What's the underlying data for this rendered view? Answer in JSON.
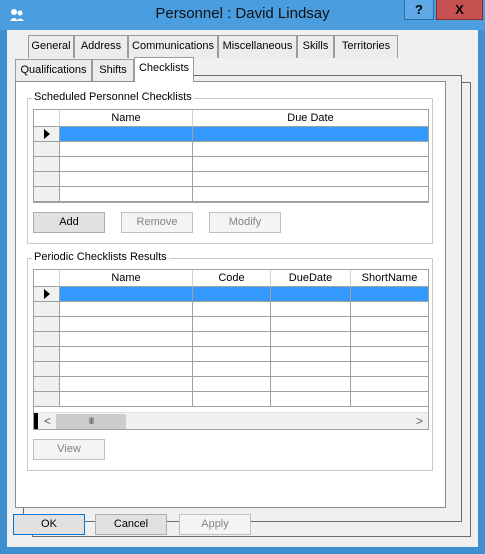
{
  "window": {
    "title": "Personnel : David Lindsay",
    "help_label": "?",
    "close_label": "X"
  },
  "tabs": {
    "row1": [
      "General",
      "Address",
      "Communications",
      "Miscellaneous",
      "Skills",
      "Territories"
    ],
    "row2": [
      "Qualifications",
      "Shifts",
      "Checklists"
    ],
    "active": "Checklists"
  },
  "scheduled": {
    "group_label": "Scheduled Personnel Checklists",
    "columns": [
      "Name",
      "Due Date"
    ],
    "add_label": "Add",
    "remove_label": "Remove",
    "modify_label": "Modify"
  },
  "periodic": {
    "group_label": "Periodic Checklists Results",
    "columns": [
      "Name",
      "Code",
      "DueDate",
      "ShortName"
    ],
    "scroll_left": "<",
    "scroll_right": ">",
    "thumb_grip": "III",
    "view_label": "View"
  },
  "footer": {
    "ok_label": "OK",
    "cancel_label": "Cancel",
    "apply_label": "Apply"
  },
  "colors": {
    "title_bar": "#4a9ee0",
    "selection": "#3399ff",
    "close_button": "#c75050"
  }
}
